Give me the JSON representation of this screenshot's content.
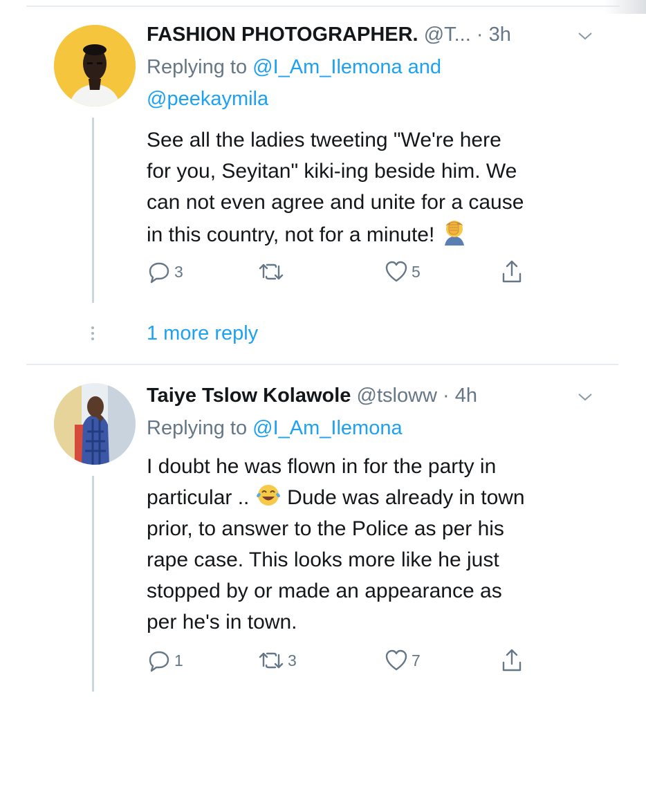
{
  "tweets": [
    {
      "name": "FASHION PHOTOGRAPHER.",
      "handle": "@T...",
      "dot": "·",
      "time": "3h",
      "replying_prefix": "Replying to",
      "replying_line1": "@I_Am_Ilemona and",
      "replying_line2": "@peekaymila",
      "text_line1": "See all the ladies tweeting \"We're here",
      "text_line2": "for you, Seyitan\" kiki-ing beside him. We",
      "text_line3": "can not even agree and unite for a cause",
      "text_line4": "in this country, not for a minute!",
      "emoji": "facepalm-emoji",
      "reply_count": "3",
      "retweet_count": "",
      "like_count": "5"
    },
    {
      "name": "Taiye Tslow Kolawole",
      "handle": "@tsloww",
      "dot": "·",
      "time": "4h",
      "replying_prefix": "Replying to",
      "replying_line1": "@I_Am_Ilemona",
      "text_line1": "I doubt he was flown in for the party in",
      "text_line2a": "particular ..",
      "text_line2b": "Dude was already in town",
      "text_line3": "prior, to answer to the Police as per his",
      "text_line4": "rape case. This looks more like he just",
      "text_line5": "stopped by or made an appearance as",
      "text_line6": "per he's in town.",
      "emoji": "tears-of-joy-emoji",
      "reply_count": "1",
      "retweet_count": "3",
      "like_count": "7"
    }
  ],
  "more_replies": "1 more reply",
  "colors": {
    "link": "#1da1f2",
    "muted": "#657786",
    "line": "#ccd6dd"
  },
  "icons": [
    "reply-icon",
    "retweet-icon",
    "like-icon",
    "share-icon",
    "chevron-down-icon"
  ]
}
